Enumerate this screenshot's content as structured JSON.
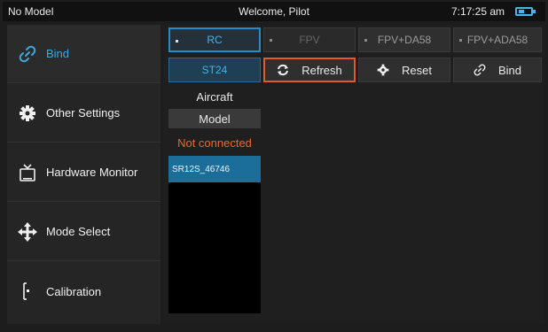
{
  "status": {
    "model": "No Model",
    "welcome": "Welcome, Pilot",
    "time": "7:17:25 am",
    "battery_icon": "battery-icon"
  },
  "sidebar": {
    "items": [
      {
        "label": "Bind",
        "icon": "link-icon",
        "active": true
      },
      {
        "label": "Other Settings",
        "icon": "gear-icon",
        "active": false
      },
      {
        "label": "Hardware Monitor",
        "icon": "monitor-icon",
        "active": false
      },
      {
        "label": "Mode Select",
        "icon": "move-arrows-icon",
        "active": false
      },
      {
        "label": "Calibration",
        "icon": "calibration-icon",
        "active": false
      }
    ]
  },
  "modes": [
    {
      "label": "RC",
      "selected": true
    },
    {
      "label": "FPV",
      "selected": false
    },
    {
      "label": "FPV+DA58",
      "selected": false
    },
    {
      "label": "FPV+ADA58",
      "selected": false
    }
  ],
  "protocol": {
    "label": "ST24"
  },
  "actions": {
    "refresh": "Refresh",
    "reset": "Reset",
    "bind": "Bind"
  },
  "aircraft": {
    "header": "Aircraft",
    "model_header": "Model",
    "status": "Not connected",
    "list": [
      "SR12S_46746"
    ]
  },
  "colors": {
    "accent": "#2a8cc6",
    "highlight": "#e15b2f",
    "status_warning": "#e8692f",
    "list_selected": "#1b6e99"
  }
}
